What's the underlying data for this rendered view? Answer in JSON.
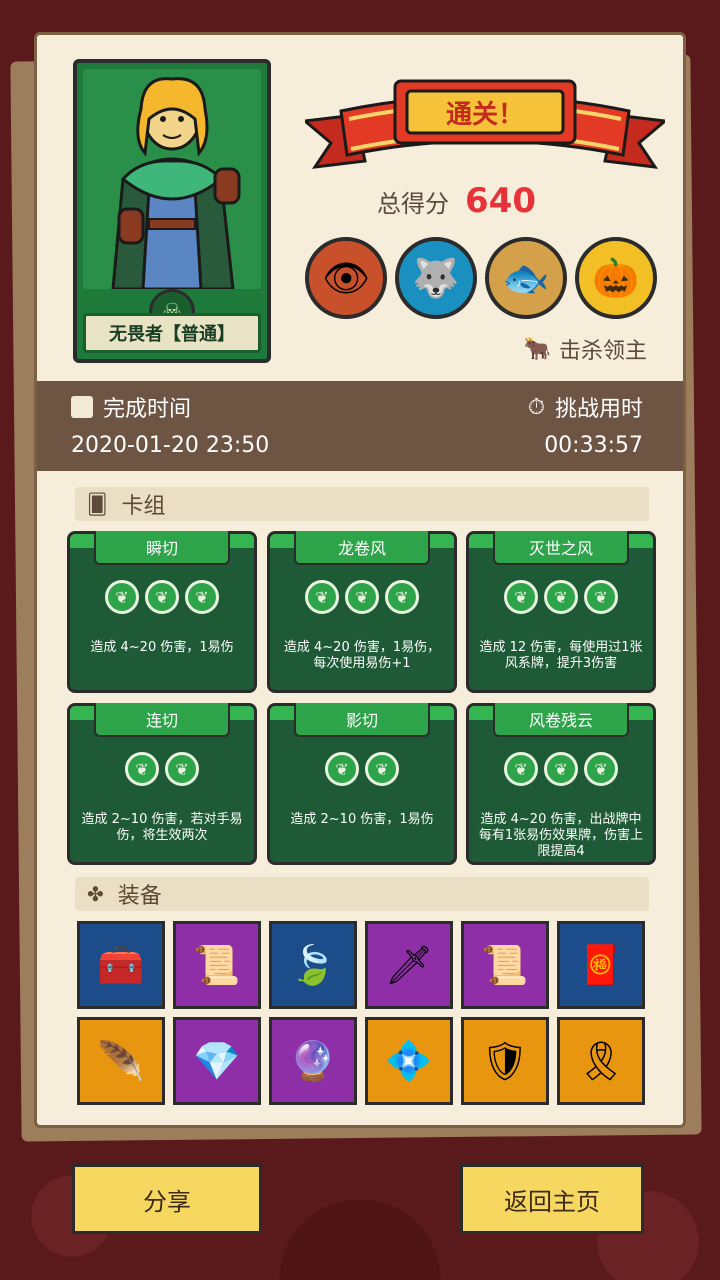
{
  "hero": {
    "name": "无畏者【普通】"
  },
  "result": {
    "banner": "通关！",
    "score_label": "总得分",
    "score_value": "640",
    "kill_label": "击杀领主"
  },
  "bosses": [
    {
      "name": "eye-demon-icon",
      "glyph": "👁",
      "bg": "#c8502a"
    },
    {
      "name": "shadow-beast-icon",
      "glyph": "🐺",
      "bg": "#1a90c0"
    },
    {
      "name": "fish-beast-icon",
      "glyph": "🐟",
      "bg": "#d4a04a"
    },
    {
      "name": "pumpkin-king-icon",
      "glyph": "🎃",
      "bg": "#f2c024"
    }
  ],
  "info": {
    "finish_label": "完成时间",
    "finish_value": "2020-01-20 23:50",
    "duration_label": "挑战用时",
    "duration_value": "00:33:57"
  },
  "deck": {
    "title": "卡组",
    "cards": [
      {
        "name": "瞬切",
        "orbs": 3,
        "desc": "造成 4~20 伤害，1易伤"
      },
      {
        "name": "龙卷风",
        "orbs": 3,
        "desc": "造成 4~20 伤害，1易伤，每次使用易伤+1"
      },
      {
        "name": "灭世之风",
        "orbs": 3,
        "desc": "造成 12 伤害，每使用过1张风系牌，提升3伤害"
      },
      {
        "name": "连切",
        "orbs": 2,
        "desc": "造成 2~10 伤害，若对手易伤，将生效两次"
      },
      {
        "name": "影切",
        "orbs": 2,
        "desc": "造成 2~10 伤害，1易伤"
      },
      {
        "name": "风卷残云",
        "orbs": 3,
        "desc": "造成 4~20 伤害，出战牌中每有1张易伤效果牌，伤害上限提高4"
      }
    ]
  },
  "equipment": {
    "title": "装备",
    "items": [
      {
        "name": "treasure-chest-icon",
        "glyph": "🧰",
        "color": "blue"
      },
      {
        "name": "fire-scroll-icon",
        "glyph": "📜",
        "color": "purple"
      },
      {
        "name": "leaves-icon",
        "glyph": "🍃",
        "color": "blue"
      },
      {
        "name": "dagger-icon",
        "glyph": "🗡",
        "color": "purple"
      },
      {
        "name": "scroll-icon",
        "glyph": "📜",
        "color": "purple"
      },
      {
        "name": "talisman-icon",
        "glyph": "🧧",
        "color": "blue"
      },
      {
        "name": "feather-icon",
        "glyph": "🪶",
        "color": "orange"
      },
      {
        "name": "ruby-icon",
        "glyph": "💎",
        "color": "purple"
      },
      {
        "name": "pink-gem-icon",
        "glyph": "🔮",
        "color": "purple"
      },
      {
        "name": "crystal-icon",
        "glyph": "💠",
        "color": "orange"
      },
      {
        "name": "amulet-icon",
        "glyph": "🛡",
        "color": "orange"
      },
      {
        "name": "charm-scroll-icon",
        "glyph": "🎗",
        "color": "orange"
      }
    ]
  },
  "buttons": {
    "share": "分享",
    "home": "返回主页"
  }
}
